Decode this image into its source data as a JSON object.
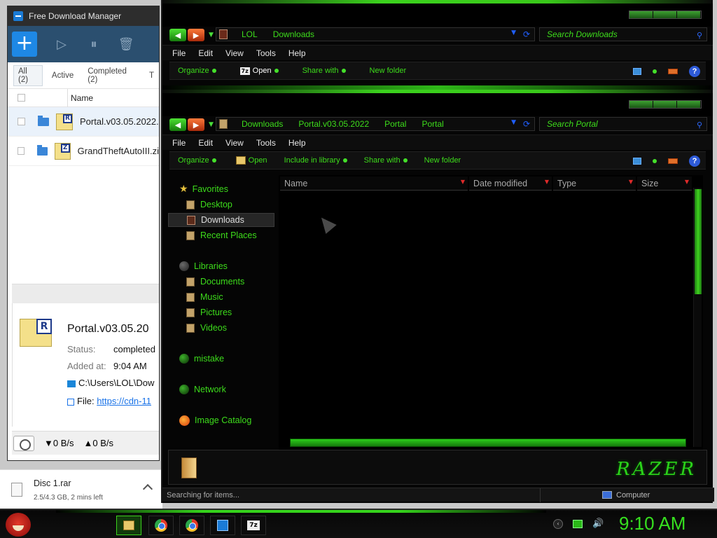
{
  "fdm": {
    "title": "Free Download Manager",
    "filters": [
      "All (2)",
      "Active",
      "Completed (2)",
      "T"
    ],
    "column_name": "Name",
    "rows": [
      {
        "name": "Portal.v03.05.2022.",
        "badge": "R"
      },
      {
        "name": "GrandTheftAutoIII.zi",
        "badge": "Z"
      }
    ],
    "details": {
      "title": "Portal.v03.05.20",
      "badge": "R",
      "status_label": "Status:",
      "status_value": "completed",
      "added_label": "Added at:",
      "added_value": "9:04 AM",
      "path": "C:\\Users\\LOL\\Dow",
      "file_label": "File:",
      "file_link": "https://cdn-11"
    },
    "status": {
      "down": "▼0 B/s",
      "up": "▲0 B/s"
    }
  },
  "download_bar": {
    "name": "Disc 1.rar",
    "progress": "2.5/4.3 GB, 2 mins left"
  },
  "explorer1": {
    "address": [
      "LOL",
      "Downloads"
    ],
    "search_placeholder": "Search Downloads",
    "menu": [
      "File",
      "Edit",
      "View",
      "Tools",
      "Help"
    ],
    "commands": {
      "organize": "Organize",
      "open": "Open",
      "share": "Share with",
      "new_folder": "New folder"
    }
  },
  "explorer2": {
    "address": [
      "Downloads",
      "Portal.v03.05.2022",
      "Portal",
      "Portal"
    ],
    "search_placeholder": "Search Portal",
    "menu": [
      "File",
      "Edit",
      "View",
      "Tools",
      "Help"
    ],
    "commands": {
      "organize": "Organize",
      "open": "Open",
      "include": "Include in library",
      "share": "Share with",
      "new_folder": "New folder"
    },
    "nav": {
      "favorites": "Favorites",
      "desktop": "Desktop",
      "downloads": "Downloads",
      "recent": "Recent Places",
      "libraries": "Libraries",
      "documents": "Documents",
      "music": "Music",
      "pictures": "Pictures",
      "videos": "Videos",
      "mistake": "mistake",
      "network": "Network",
      "image_catalog": "Image Catalog"
    },
    "columns": [
      "Name",
      "Date modified",
      "Type",
      "Size"
    ],
    "brand": "RAZER",
    "status_left": "Searching for items...",
    "status_right": "Computer"
  },
  "taskbar": {
    "clock": "9:10 AM",
    "apps": [
      "explorer-icon",
      "chrome-icon",
      "chrome-icon",
      "fdm-icon",
      "7zip-icon"
    ],
    "seven_zip": "7z"
  },
  "colors": {
    "accent_green": "#3ddc1b",
    "fdm_toolbar": "#2b4f6f",
    "fdm_add": "#1e88e5"
  }
}
